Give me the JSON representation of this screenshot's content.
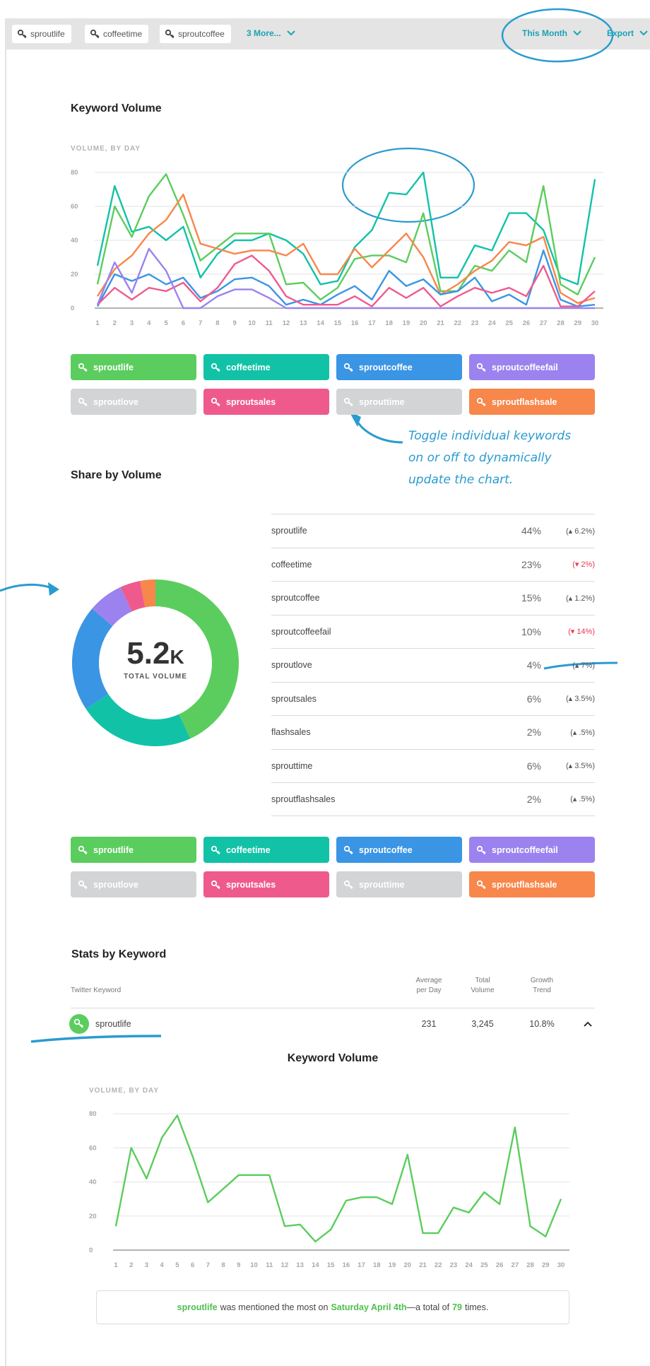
{
  "colors": {
    "sproutlife": "#5bcd5e",
    "coffeetime": "#12c2a7",
    "sproutcoffee": "#3a95e4",
    "sproutcoffeefail": "#9b82ef",
    "sproutlove": "#d2d4d6",
    "sproutsales": "#ef5a8d",
    "sprouttime": "#d2d4d6",
    "sproutflashsale": "#f7874b",
    "accent": "#1aa3b5",
    "annotation": "#2a9bd0",
    "negative": "#e8384f"
  },
  "filter_bar": {
    "chips": [
      "sproutlife",
      "coffeetime",
      "sproutcoffee"
    ],
    "more_label": "3 More...",
    "range_label": "This Month",
    "export_label": "Export"
  },
  "keyword_volume": {
    "title": "Keyword Volume",
    "axis_caption": "VOLUME, BY DAY"
  },
  "toggles": [
    {
      "label": "sproutlife",
      "color": "#5bcd5e",
      "active": true
    },
    {
      "label": "coffeetime",
      "color": "#12c2a7",
      "active": true
    },
    {
      "label": "sproutcoffee",
      "color": "#3a95e4",
      "active": true
    },
    {
      "label": "sproutcoffeefail",
      "color": "#9b82ef",
      "active": true
    },
    {
      "label": "sproutlove",
      "color": "#d2d4d6",
      "active": false
    },
    {
      "label": "sproutsales",
      "color": "#ef5a8d",
      "active": true
    },
    {
      "label": "sprouttime",
      "color": "#d2d4d6",
      "active": false
    },
    {
      "label": "sproutflashsale",
      "color": "#f7874b",
      "active": true
    }
  ],
  "annotation_text": [
    "Toggle individual keywords",
    "on or off to dynamically",
    "update the chart."
  ],
  "share": {
    "title": "Share by Volume",
    "total_number": "5.2",
    "total_suffix": "K",
    "total_label": "TOTAL VOLUME",
    "rows": [
      {
        "name": "sproutlife",
        "pct": "44%",
        "change": "(▴ 6.2%)",
        "negative": false
      },
      {
        "name": "coffeetime",
        "pct": "23%",
        "change": "(▾ 2%)",
        "negative": true
      },
      {
        "name": "sproutcoffee",
        "pct": "15%",
        "change": "(▴ 1.2%)",
        "negative": false
      },
      {
        "name": "sproutcoffeefail",
        "pct": "10%",
        "change": "(▾ 14%)",
        "negative": true
      },
      {
        "name": "sproutlove",
        "pct": "4%",
        "change": "(▴ 7%)",
        "negative": false
      },
      {
        "name": "sproutsales",
        "pct": "6%",
        "change": "(▴ 3.5%)",
        "negative": false
      },
      {
        "name": "flashsales",
        "pct": "2%",
        "change": "(▴ .5%)",
        "negative": false
      },
      {
        "name": "sprouttime",
        "pct": "6%",
        "change": "(▴ 3.5%)",
        "negative": false
      },
      {
        "name": "sproutflashsales",
        "pct": "2%",
        "change": "(▴ .5%)",
        "negative": false
      }
    ]
  },
  "stats": {
    "title": "Stats by Keyword",
    "col_keyword": "Twitter Keyword",
    "col_avg": "Average per Day",
    "col_total": "Total Volume",
    "col_growth": "Growth Trend",
    "row": {
      "keyword": "sproutlife",
      "avg": "231",
      "total": "3,245",
      "growth": "10.8%"
    },
    "detail_title": "Keyword Volume",
    "detail_caption": "VOLUME, BY DAY"
  },
  "summary": {
    "keyword": "sproutlife",
    "text1": "was mentioned the most on",
    "date": "Saturday April 4th",
    "text2": "—a total of",
    "count": "79",
    "text3": "times."
  },
  "chart_data": [
    {
      "type": "line",
      "title": "Keyword Volume",
      "ylabel": "VOLUME, BY DAY",
      "ylim": [
        0,
        80
      ],
      "yticks": [
        0,
        20,
        40,
        60,
        80
      ],
      "x": [
        1,
        2,
        3,
        4,
        5,
        6,
        7,
        8,
        9,
        10,
        11,
        12,
        13,
        14,
        15,
        16,
        17,
        18,
        19,
        20,
        21,
        22,
        23,
        24,
        25,
        26,
        27,
        28,
        29,
        30
      ],
      "series": [
        {
          "name": "coffeetime",
          "color": "#12c2a7",
          "values": [
            25,
            72,
            45,
            48,
            40,
            48,
            18,
            32,
            40,
            40,
            44,
            40,
            32,
            14,
            16,
            36,
            46,
            68,
            67,
            80,
            18,
            18,
            37,
            34,
            56,
            56,
            46,
            18,
            14,
            76
          ]
        },
        {
          "name": "sproutlife",
          "color": "#5bcd5e",
          "values": [
            14,
            60,
            42,
            66,
            79,
            55,
            28,
            36,
            44,
            44,
            44,
            14,
            15,
            5,
            12,
            29,
            31,
            31,
            27,
            56,
            10,
            10,
            25,
            22,
            34,
            27,
            72,
            14,
            8,
            30
          ]
        },
        {
          "name": "sproutflashsale",
          "color": "#f7874b",
          "values": [
            7,
            23,
            31,
            44,
            52,
            67,
            38,
            35,
            32,
            34,
            34,
            31,
            38,
            20,
            20,
            35,
            24,
            34,
            44,
            30,
            8,
            14,
            22,
            28,
            39,
            37,
            42,
            9,
            3,
            6
          ]
        },
        {
          "name": "sproutcoffee",
          "color": "#3a95e4",
          "values": [
            1,
            20,
            16,
            20,
            14,
            18,
            6,
            10,
            17,
            18,
            13,
            2,
            5,
            2,
            8,
            13,
            5,
            22,
            13,
            17,
            8,
            10,
            18,
            4,
            8,
            2,
            34,
            5,
            1,
            2
          ]
        },
        {
          "name": "sproutsales",
          "color": "#ef5a8d",
          "values": [
            2,
            12,
            5,
            12,
            10,
            15,
            4,
            12,
            26,
            31,
            22,
            7,
            2,
            2,
            2,
            7,
            1,
            12,
            6,
            12,
            1,
            7,
            12,
            9,
            12,
            7,
            25,
            1,
            1,
            10
          ]
        },
        {
          "name": "sproutcoffeefail",
          "color": "#9b82ef",
          "values": [
            2,
            27,
            9,
            35,
            22,
            0,
            0,
            7,
            11,
            11,
            6,
            0,
            0,
            0,
            0,
            0,
            0,
            0,
            0,
            0,
            0,
            0,
            0,
            0,
            0,
            0,
            0,
            0,
            0,
            0
          ]
        }
      ]
    },
    {
      "type": "pie",
      "labels": [
        "sproutlife",
        "coffeetime",
        "sproutcoffee",
        "sproutcoffeefail",
        "sproutsales",
        "sproutflashsale"
      ],
      "values": [
        44,
        23,
        21,
        7,
        4,
        3
      ],
      "colors": [
        "#5bcd5e",
        "#12c2a7",
        "#3a95e4",
        "#9b82ef",
        "#ef5a8d",
        "#f7874b"
      ]
    },
    {
      "type": "line",
      "title": "Keyword Volume",
      "ylabel": "VOLUME, BY DAY",
      "ylim": [
        0,
        80
      ],
      "yticks": [
        0,
        20,
        40,
        60,
        80
      ],
      "x": [
        1,
        2,
        3,
        4,
        5,
        6,
        7,
        8,
        9,
        10,
        11,
        12,
        13,
        14,
        15,
        16,
        17,
        18,
        19,
        20,
        21,
        22,
        23,
        24,
        25,
        26,
        27,
        28,
        29,
        30
      ],
      "series": [
        {
          "name": "sproutlife",
          "color": "#5bcd5e",
          "values": [
            14,
            60,
            42,
            66,
            79,
            55,
            28,
            36,
            44,
            44,
            44,
            14,
            15,
            5,
            12,
            29,
            31,
            31,
            27,
            56,
            10,
            10,
            25,
            22,
            34,
            27,
            72,
            14,
            8,
            30
          ]
        }
      ]
    }
  ]
}
